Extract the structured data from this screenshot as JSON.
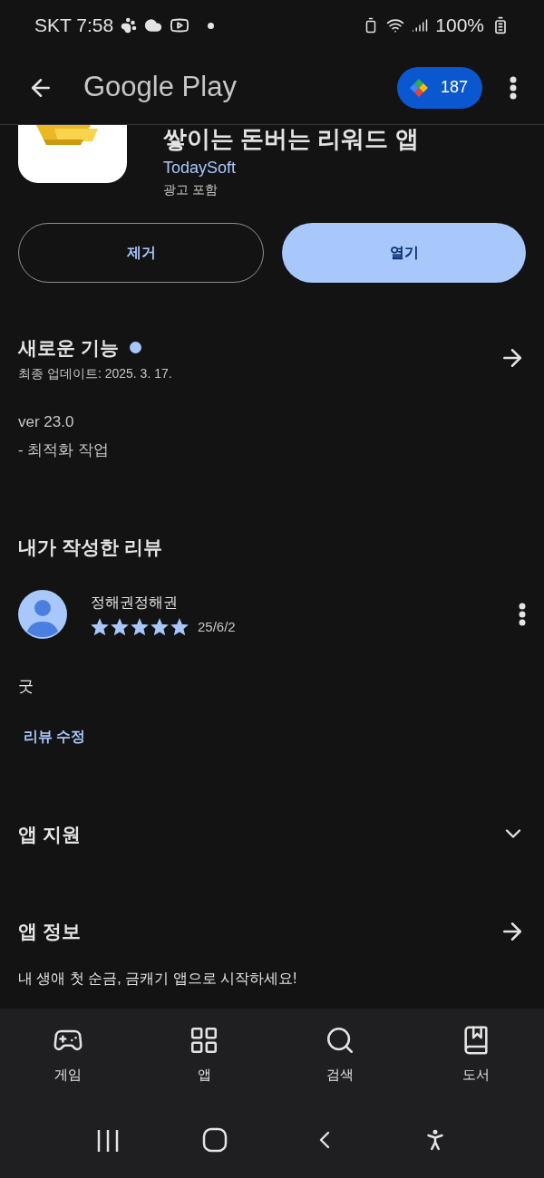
{
  "status_bar": {
    "carrier_time": "SKT 7:58",
    "battery": "100%"
  },
  "header": {
    "title": "Google Play",
    "points": "187"
  },
  "app": {
    "title": "쌓이는 돈버는 리워드 앱",
    "developer": "TodaySoft",
    "ads": "광고 포함"
  },
  "buttons": [
    {
      "label": "제거",
      "kind": "outline"
    },
    {
      "label": "열기",
      "kind": "filled"
    }
  ],
  "whats_new": {
    "title": "새로운 기능",
    "new": true,
    "updated": "최종 업데이트: 2025. 3. 17.",
    "notes": [
      "ver 23.0",
      "- 최적화 작업"
    ]
  },
  "my_review": {
    "heading": "내가 작성한 리뷰",
    "author": "정해권정해권",
    "stars": 5,
    "date": "25/6/2",
    "text": "굿",
    "edit_link": "리뷰 수정"
  },
  "sections": [
    {
      "title": "앱 지원",
      "kind": "expand"
    },
    {
      "title": "앱 정보",
      "kind": "arrow",
      "description": "내 생애 첫 순금, 금캐기 앱으로 시작하세요!"
    }
  ],
  "bottom_nav": [
    {
      "label": "게임",
      "selected": false
    },
    {
      "label": "앱",
      "selected": false
    },
    {
      "label": "검색",
      "selected": false
    },
    {
      "label": "도서",
      "selected": false
    }
  ]
}
